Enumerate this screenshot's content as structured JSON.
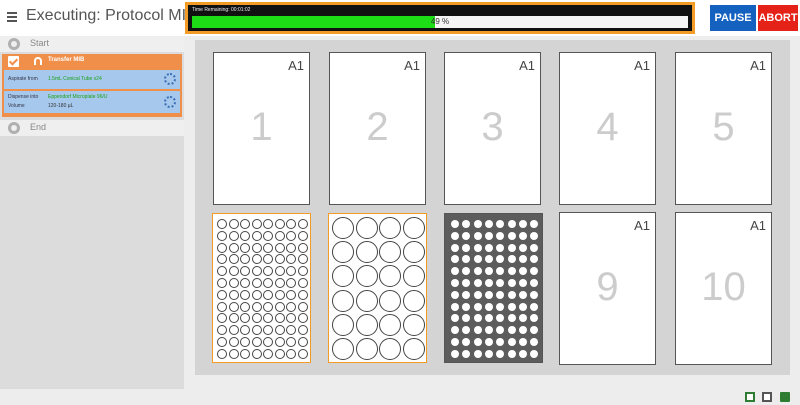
{
  "header": {
    "title": "Executing: Protocol MIB",
    "time_remaining": "Time Remaining: 00:01:02",
    "progress_percent": 49,
    "progress_label": "49 %",
    "pause_label": "PAUSE",
    "abort_label": "ABORT"
  },
  "sidebar": {
    "start_label": "Start",
    "end_label": "End",
    "task": {
      "title": "Transfer MIB",
      "aspirate_label": "Aspirate from",
      "aspirate_value": "1.5mL Conical Tube x24",
      "dispense_label": "Dispense into",
      "dispense_value": "Eppendorf Microplate 96/U",
      "volume_label": "Volume",
      "volume_value": "120-180 µL"
    }
  },
  "deck": {
    "top_slots": [
      {
        "tag": "A1",
        "number": "1"
      },
      {
        "tag": "A1",
        "number": "2"
      },
      {
        "tag": "A1",
        "number": "3"
      },
      {
        "tag": "A1",
        "number": "4"
      },
      {
        "tag": "A1",
        "number": "5"
      }
    ],
    "bottom_slots": [
      {
        "tag": "A1",
        "number": "9"
      },
      {
        "tag": "A1",
        "number": "10"
      }
    ]
  },
  "colors": {
    "accent_orange": "#f39b27",
    "progress_green": "#1ddd16",
    "pause_blue": "#1561bf",
    "abort_red": "#e52217"
  },
  "icons": [
    "menu-icon",
    "checkbox-icon",
    "headphone-icon",
    "spinner-icon",
    "clipboard-icon",
    "add-icon",
    "copy-icon",
    "trash-icon"
  ]
}
